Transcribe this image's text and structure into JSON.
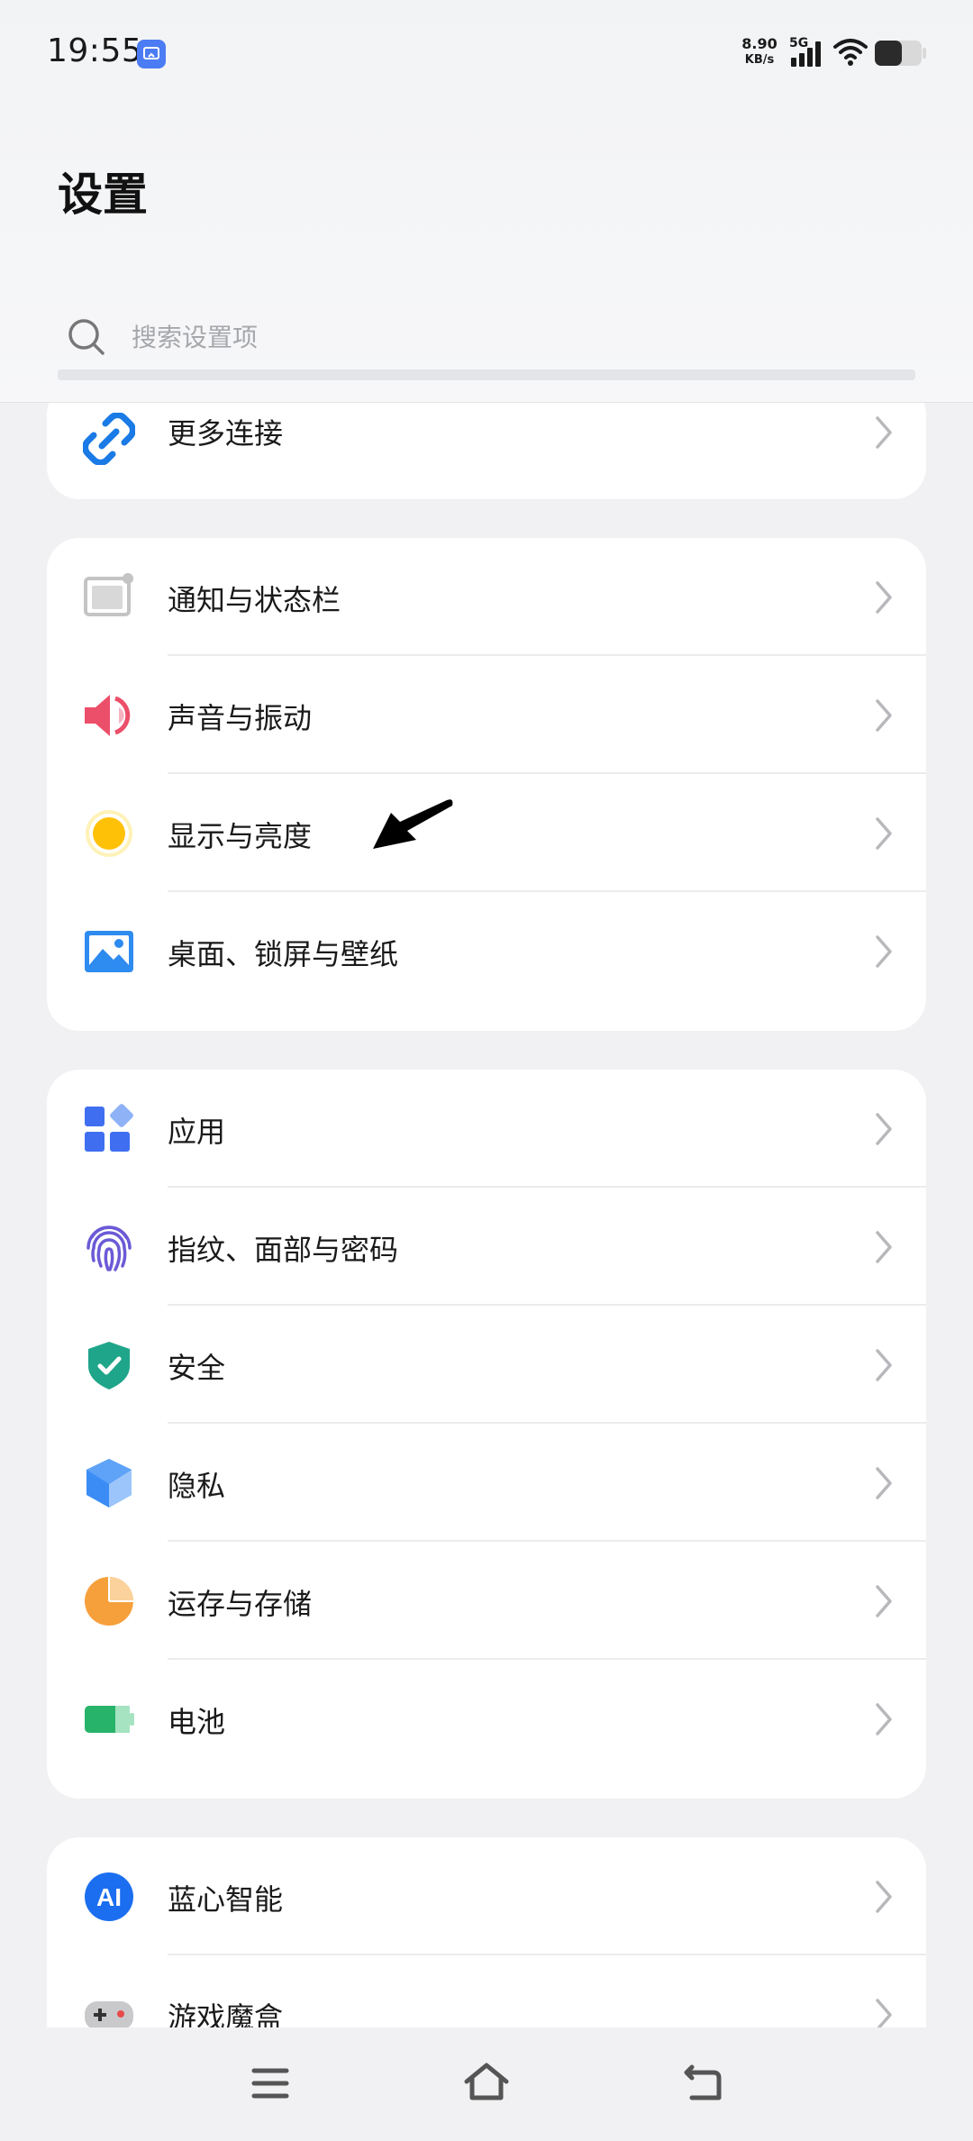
{
  "status_bar": {
    "time": "19:55",
    "net_speed_value": "8.90",
    "net_speed_unit": "KB/s",
    "network_type": "5G",
    "icons": [
      "screen-cast-icon",
      "signal-bars-icon",
      "wifi-icon",
      "battery-icon"
    ]
  },
  "header": {
    "title": "设置",
    "search_placeholder": "搜索设置项"
  },
  "groups": [
    {
      "items": [
        {
          "label": "更多连接",
          "icon": "link-icon",
          "color": "#1a7ae6"
        }
      ]
    },
    {
      "items": [
        {
          "label": "通知与状态栏",
          "icon": "notification-icon",
          "color": "#bdbdbd"
        },
        {
          "label": "声音与振动",
          "icon": "speaker-icon",
          "color": "#ec4f6a"
        },
        {
          "label": "显示与亮度",
          "icon": "brightness-icon",
          "color": "#ffc107"
        },
        {
          "label": "桌面、锁屏与壁纸",
          "icon": "wallpaper-icon",
          "color": "#2e8bf0"
        }
      ]
    },
    {
      "items": [
        {
          "label": "应用",
          "icon": "apps-icon",
          "color": "#3f6ff0"
        },
        {
          "label": "指纹、面部与密码",
          "icon": "fingerprint-icon",
          "color": "#6a5ad6"
        },
        {
          "label": "安全",
          "icon": "shield-icon",
          "color": "#1fa58a"
        },
        {
          "label": "隐私",
          "icon": "privacy-cube-icon",
          "color": "#3b8cf5"
        },
        {
          "label": "运存与存储",
          "icon": "storage-pie-icon",
          "color": "#f6a03b"
        },
        {
          "label": "电池",
          "icon": "battery-setting-icon",
          "color": "#27b36a"
        }
      ]
    },
    {
      "items": [
        {
          "label": "蓝心智能",
          "icon": "ai-icon",
          "color": "#1b6ef0"
        },
        {
          "label": "游戏魔盒",
          "icon": "gamepad-icon",
          "color": "#bdbdbd"
        }
      ]
    }
  ],
  "nav_bar": {
    "buttons": [
      "menu-icon",
      "home-icon",
      "back-icon"
    ]
  }
}
